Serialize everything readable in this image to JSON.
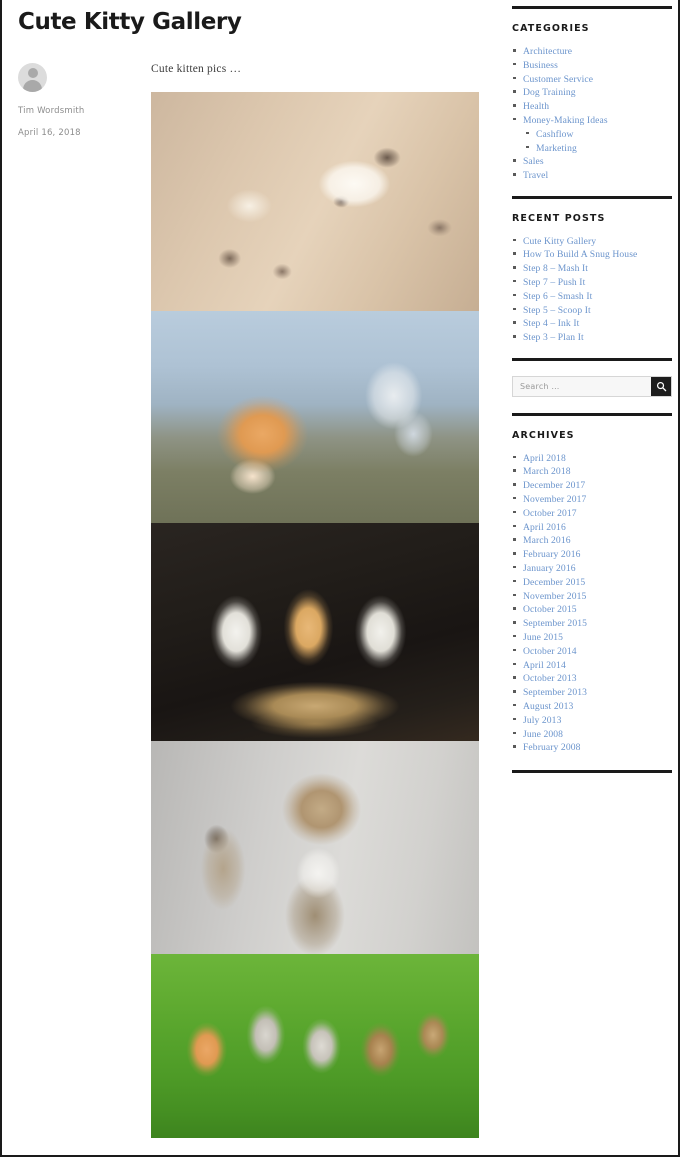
{
  "post": {
    "title": "Cute Kitty Gallery",
    "author": "Tim Wordsmith",
    "date": "April 16, 2018",
    "excerpt": "Cute kitten pics  …",
    "avatar_icon": "user-avatar-icon",
    "gallery": [
      {
        "alt": "Sleeping cream ragdoll kitten curled on a beige fabric chair"
      },
      {
        "alt": "Fluffy ginger kitten lying down with a blurred white kitten behind"
      },
      {
        "alt": "Three fluffy kittens sitting together in a wicker basket"
      },
      {
        "alt": "Tabby cat squinting with eyes closed against a grey background"
      },
      {
        "alt": "Five kittens walking together across green grass"
      }
    ]
  },
  "sidebar": {
    "categories": {
      "title": "Categories",
      "items": [
        {
          "label": "Architecture",
          "sub": false
        },
        {
          "label": "Business",
          "sub": false
        },
        {
          "label": "Customer Service",
          "sub": false
        },
        {
          "label": "Dog Training",
          "sub": false
        },
        {
          "label": "Health",
          "sub": false
        },
        {
          "label": "Money-Making Ideas",
          "sub": false
        },
        {
          "label": "Cashflow",
          "sub": true
        },
        {
          "label": "Marketing",
          "sub": true
        },
        {
          "label": "Sales",
          "sub": false
        },
        {
          "label": "Travel",
          "sub": false
        }
      ]
    },
    "recent_posts": {
      "title": "Recent Posts",
      "items": [
        {
          "label": "Cute Kitty Gallery"
        },
        {
          "label": "How To Build A Snug House"
        },
        {
          "label": "Step 8 – Mash It"
        },
        {
          "label": "Step 7 – Push It"
        },
        {
          "label": "Step 6 – Smash It"
        },
        {
          "label": "Step 5 – Scoop It"
        },
        {
          "label": "Step 4 – Ink It"
        },
        {
          "label": "Step 3 – Plan It"
        }
      ]
    },
    "search": {
      "placeholder": "Search …",
      "value": "",
      "button_icon": "search-icon"
    },
    "archives": {
      "title": "Archives",
      "items": [
        {
          "label": "April 2018"
        },
        {
          "label": "March 2018"
        },
        {
          "label": "December 2017"
        },
        {
          "label": "November 2017"
        },
        {
          "label": "October 2017"
        },
        {
          "label": "April 2016"
        },
        {
          "label": "March 2016"
        },
        {
          "label": "February 2016"
        },
        {
          "label": "January 2016"
        },
        {
          "label": "December 2015"
        },
        {
          "label": "November 2015"
        },
        {
          "label": "October 2015"
        },
        {
          "label": "September 2015"
        },
        {
          "label": "June 2015"
        },
        {
          "label": "October 2014"
        },
        {
          "label": "April 2014"
        },
        {
          "label": "October 2013"
        },
        {
          "label": "September 2013"
        },
        {
          "label": "August 2013"
        },
        {
          "label": "July 2013"
        },
        {
          "label": "June 2008"
        },
        {
          "label": "February 2008"
        }
      ]
    }
  },
  "colors": {
    "link": "#6b94cc",
    "text": "#1a1a1a",
    "muted": "#8d8d8d",
    "rule": "#1a1a1a",
    "search_button_bg": "#1d1d1d"
  }
}
